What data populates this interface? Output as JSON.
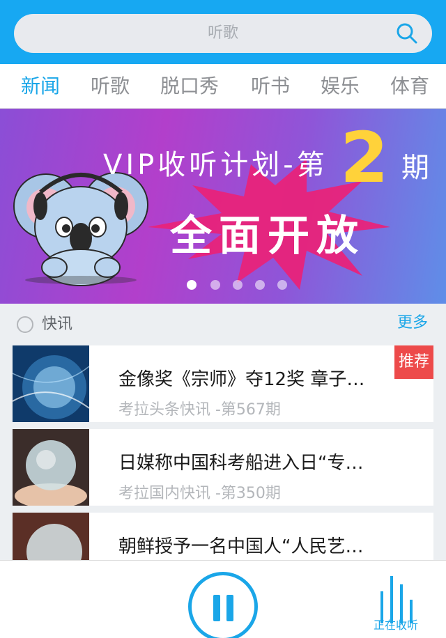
{
  "search": {
    "placeholder": "听歌"
  },
  "tabs": [
    {
      "label": "新闻",
      "active": true
    },
    {
      "label": "听歌",
      "active": false
    },
    {
      "label": "脱口秀",
      "active": false
    },
    {
      "label": "听书",
      "active": false
    },
    {
      "label": "娱乐",
      "active": false
    },
    {
      "label": "体育",
      "active": false
    }
  ],
  "banner": {
    "line1": "VIP收听计划-第",
    "number": "2",
    "suffix": "期",
    "main": "全面开放",
    "active_dot": 1,
    "dot_count": 5
  },
  "section": {
    "title": "快讯",
    "more": "更多"
  },
  "items": [
    {
      "title": "金像奖《宗师》夺12奖 章子…",
      "subtitle": "考拉头条快讯 -第567期",
      "badge": "推荐"
    },
    {
      "title": "日媒称中国科考船进入日“专…",
      "subtitle": "考拉国内快讯 -第350期"
    },
    {
      "title": "朝鲜授予一名中国人“人民艺…",
      "subtitle": ""
    }
  ],
  "bottom": {
    "listen_label": "正在收听"
  },
  "colors": {
    "accent": "#1aa6e8",
    "header": "#17a8f2",
    "badge": "#ed4a4a"
  }
}
